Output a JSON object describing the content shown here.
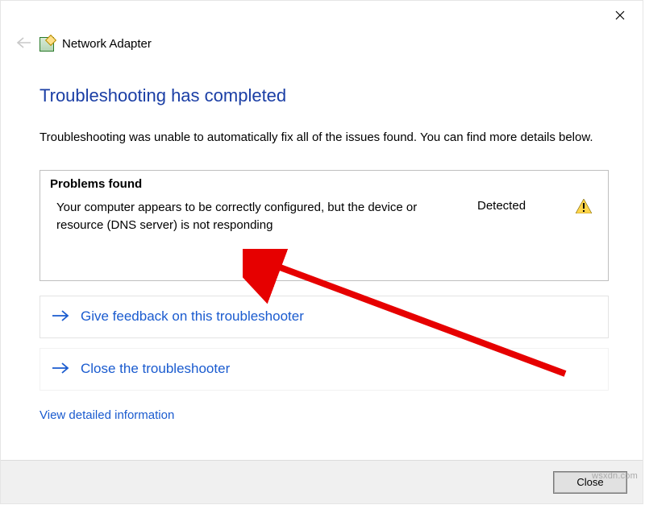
{
  "window": {
    "title": "Network Adapter"
  },
  "heading": "Troubleshooting has completed",
  "subtext": "Troubleshooting was unable to automatically fix all of the issues found. You can find more details below.",
  "panel": {
    "title": "Problems found",
    "issue": "Your computer appears to be correctly configured, but the device or resource (DNS server) is not responding",
    "status": "Detected"
  },
  "actions": {
    "feedback": "Give feedback on this troubleshooter",
    "close_troubleshooter": "Close the troubleshooter",
    "view_details": "View detailed information"
  },
  "footer": {
    "close": "Close"
  },
  "watermark": "wsxdn.com"
}
